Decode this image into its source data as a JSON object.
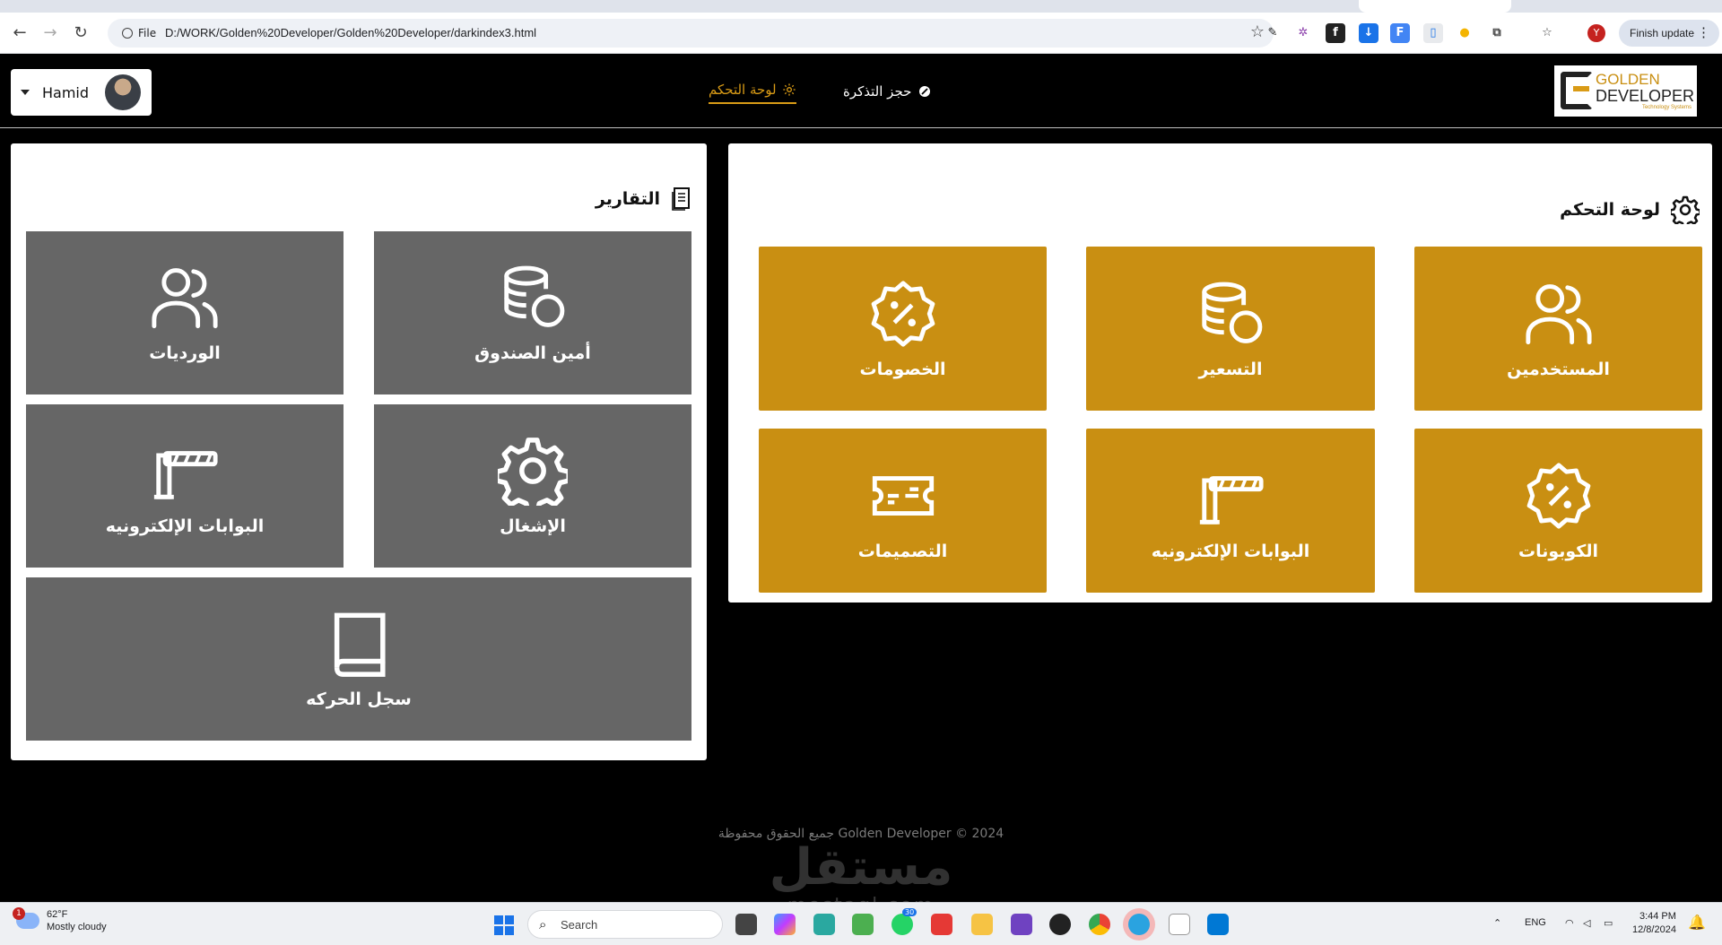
{
  "browser": {
    "file_label": "File",
    "url": "D:/WORK/Golden%20Developer/Golden%20Developer/darkindex3.html",
    "profile_initial": "Y",
    "finish_update_label": "Finish update"
  },
  "header": {
    "user_name": "Hamid",
    "nav": {
      "dashboard": "لوحة التحكم",
      "booking": "حجز التذكرة"
    },
    "brand": {
      "line1": "GOLDEN",
      "line2": "DEVELOPER",
      "line3": "Technology Systems"
    }
  },
  "reports": {
    "title": "التقارير",
    "tiles": [
      {
        "label": "أمين الصندوق",
        "icon": "coins-icon"
      },
      {
        "label": "الورديات",
        "icon": "users-icon"
      },
      {
        "label": "الإشغال",
        "icon": "gear-icon"
      },
      {
        "label": "البوابات الإلكترونيه",
        "icon": "barrier-gate-icon"
      },
      {
        "label": "سجل الحركه",
        "icon": "book-icon"
      }
    ]
  },
  "dashboard": {
    "title": "لوحة التحكم",
    "tiles": [
      {
        "label": "المستخدمين",
        "icon": "users-icon"
      },
      {
        "label": "التسعير",
        "icon": "coins-icon"
      },
      {
        "label": "الخصومات",
        "icon": "discount-badge-icon"
      },
      {
        "label": "الكوبونات",
        "icon": "discount-badge-icon"
      },
      {
        "label": "البوابات الإلكترونيه",
        "icon": "barrier-gate-icon"
      },
      {
        "label": "التصميمات",
        "icon": "ticket-icon"
      }
    ]
  },
  "footer": {
    "copyright": "جميع الحقوق محفوظة Golden Developer © 2024",
    "watermark": "مستقل",
    "watermark_sub": "mostaql.com"
  },
  "taskbar": {
    "weather_temp": "62°F",
    "weather_desc": "Mostly cloudy",
    "weather_badge": "1",
    "search_label": "Search",
    "whatsapp_badge": "30",
    "lang": "ENG",
    "time": "3:44 PM",
    "date": "12/8/2024"
  },
  "colors": {
    "gold": "#c98f12",
    "gray_tile": "#666666",
    "nav_active": "#d99b16"
  }
}
